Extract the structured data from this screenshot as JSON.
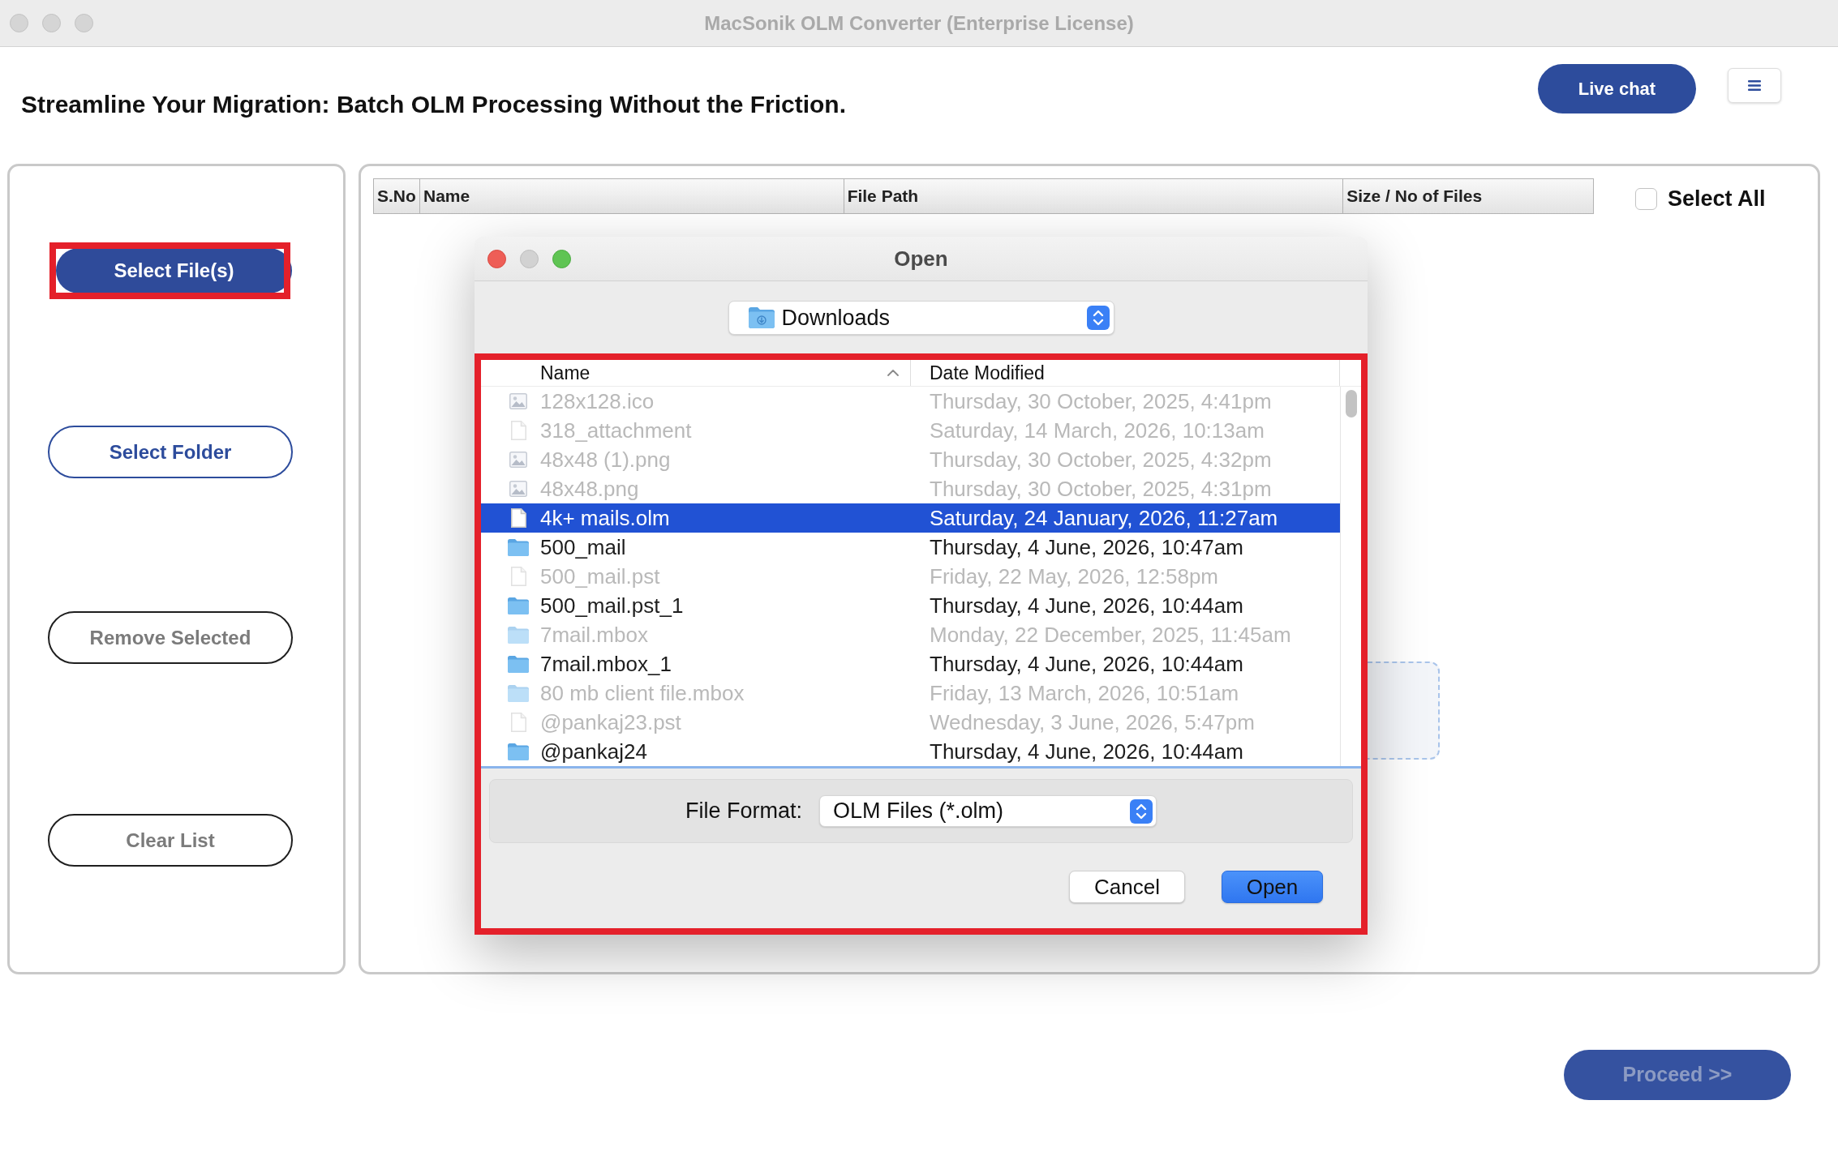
{
  "window": {
    "title": "MacSonik OLM Converter (Enterprise License)",
    "focused": false
  },
  "header": {
    "headline": "Streamline Your Migration: Batch OLM Processing Without the Friction.",
    "live_chat_button": "Live chat"
  },
  "left_buttons": [
    {
      "label": "Select File(s)",
      "kind": "filled",
      "disabled": false,
      "highlighted": true
    },
    {
      "label": "Select Folder",
      "kind": "outline",
      "disabled": false,
      "highlighted": false
    },
    {
      "label": "Remove Selected",
      "kind": "outline",
      "disabled": true,
      "highlighted": false
    },
    {
      "label": "Clear List",
      "kind": "outline",
      "disabled": true,
      "highlighted": false
    }
  ],
  "table": {
    "columns": [
      "S.No",
      "Name",
      "File Path",
      "Size / No of Files"
    ]
  },
  "select_all": {
    "label": "Select All",
    "checked": false
  },
  "open_dialog": {
    "title": "Open",
    "focused": true,
    "highlighted": true,
    "location": "Downloads",
    "list_columns": [
      {
        "label": "Name",
        "sorted": true
      },
      {
        "label": "Date Modified",
        "sorted": false
      }
    ],
    "files": [
      {
        "name": "128x128.ico",
        "date": "Thursday, 30 October, 2025, 4:41pm",
        "kind": "image",
        "disabled": true,
        "selected": false
      },
      {
        "name": "318_attachment",
        "date": "Saturday, 14 March, 2026, 10:13am",
        "kind": "document",
        "disabled": true,
        "selected": false
      },
      {
        "name": "48x48 (1).png",
        "date": "Thursday, 30 October, 2025, 4:32pm",
        "kind": "image",
        "disabled": true,
        "selected": false
      },
      {
        "name": "48x48.png",
        "date": "Thursday, 30 October, 2025, 4:31pm",
        "kind": "image",
        "disabled": true,
        "selected": false
      },
      {
        "name": "4k+ mails.olm",
        "date": "Saturday, 24 January, 2026, 11:27am",
        "kind": "document",
        "disabled": false,
        "selected": true
      },
      {
        "name": "500_mail",
        "date": "Thursday, 4 June, 2026, 10:47am",
        "kind": "folder",
        "disabled": false,
        "selected": false
      },
      {
        "name": "500_mail.pst",
        "date": "Friday, 22 May, 2026, 12:58pm",
        "kind": "document",
        "disabled": true,
        "selected": false
      },
      {
        "name": "500_mail.pst_1",
        "date": "Thursday, 4 June, 2026, 10:44am",
        "kind": "folder",
        "disabled": false,
        "selected": false
      },
      {
        "name": "7mail.mbox",
        "date": "Monday, 22 December, 2025, 11:45am",
        "kind": "folder",
        "disabled": true,
        "selected": false
      },
      {
        "name": "7mail.mbox_1",
        "date": "Thursday, 4 June, 2026, 10:44am",
        "kind": "folder",
        "disabled": false,
        "selected": false
      },
      {
        "name": "80 mb client file.mbox",
        "date": "Friday, 13 March, 2026, 10:51am",
        "kind": "folder",
        "disabled": true,
        "selected": false
      },
      {
        "name": "@pankaj23.pst",
        "date": "Wednesday, 3 June, 2026, 5:47pm",
        "kind": "document",
        "disabled": true,
        "selected": false
      },
      {
        "name": "@pankaj24",
        "date": "Thursday, 4 June, 2026, 10:44am",
        "kind": "folder",
        "disabled": false,
        "selected": false
      }
    ],
    "file_format": {
      "label": "File Format:",
      "value": "OLM Files (*.olm)"
    },
    "buttons": [
      {
        "label": "Cancel",
        "kind": "secondary"
      },
      {
        "label": "Open",
        "kind": "default"
      }
    ]
  },
  "proceed_button": {
    "label": "Proceed >>",
    "disabled": true
  }
}
